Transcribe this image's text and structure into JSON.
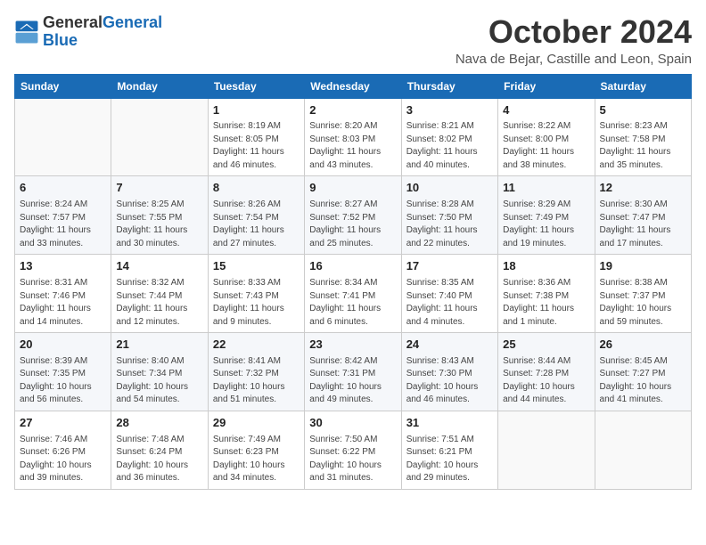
{
  "logo": {
    "line1": "General",
    "line2": "Blue"
  },
  "title": "October 2024",
  "location": "Nava de Bejar, Castille and Leon, Spain",
  "headers": [
    "Sunday",
    "Monday",
    "Tuesday",
    "Wednesday",
    "Thursday",
    "Friday",
    "Saturday"
  ],
  "weeks": [
    [
      {
        "day": "",
        "info": ""
      },
      {
        "day": "",
        "info": ""
      },
      {
        "day": "1",
        "info": "Sunrise: 8:19 AM\nSunset: 8:05 PM\nDaylight: 11 hours and 46 minutes."
      },
      {
        "day": "2",
        "info": "Sunrise: 8:20 AM\nSunset: 8:03 PM\nDaylight: 11 hours and 43 minutes."
      },
      {
        "day": "3",
        "info": "Sunrise: 8:21 AM\nSunset: 8:02 PM\nDaylight: 11 hours and 40 minutes."
      },
      {
        "day": "4",
        "info": "Sunrise: 8:22 AM\nSunset: 8:00 PM\nDaylight: 11 hours and 38 minutes."
      },
      {
        "day": "5",
        "info": "Sunrise: 8:23 AM\nSunset: 7:58 PM\nDaylight: 11 hours and 35 minutes."
      }
    ],
    [
      {
        "day": "6",
        "info": "Sunrise: 8:24 AM\nSunset: 7:57 PM\nDaylight: 11 hours and 33 minutes."
      },
      {
        "day": "7",
        "info": "Sunrise: 8:25 AM\nSunset: 7:55 PM\nDaylight: 11 hours and 30 minutes."
      },
      {
        "day": "8",
        "info": "Sunrise: 8:26 AM\nSunset: 7:54 PM\nDaylight: 11 hours and 27 minutes."
      },
      {
        "day": "9",
        "info": "Sunrise: 8:27 AM\nSunset: 7:52 PM\nDaylight: 11 hours and 25 minutes."
      },
      {
        "day": "10",
        "info": "Sunrise: 8:28 AM\nSunset: 7:50 PM\nDaylight: 11 hours and 22 minutes."
      },
      {
        "day": "11",
        "info": "Sunrise: 8:29 AM\nSunset: 7:49 PM\nDaylight: 11 hours and 19 minutes."
      },
      {
        "day": "12",
        "info": "Sunrise: 8:30 AM\nSunset: 7:47 PM\nDaylight: 11 hours and 17 minutes."
      }
    ],
    [
      {
        "day": "13",
        "info": "Sunrise: 8:31 AM\nSunset: 7:46 PM\nDaylight: 11 hours and 14 minutes."
      },
      {
        "day": "14",
        "info": "Sunrise: 8:32 AM\nSunset: 7:44 PM\nDaylight: 11 hours and 12 minutes."
      },
      {
        "day": "15",
        "info": "Sunrise: 8:33 AM\nSunset: 7:43 PM\nDaylight: 11 hours and 9 minutes."
      },
      {
        "day": "16",
        "info": "Sunrise: 8:34 AM\nSunset: 7:41 PM\nDaylight: 11 hours and 6 minutes."
      },
      {
        "day": "17",
        "info": "Sunrise: 8:35 AM\nSunset: 7:40 PM\nDaylight: 11 hours and 4 minutes."
      },
      {
        "day": "18",
        "info": "Sunrise: 8:36 AM\nSunset: 7:38 PM\nDaylight: 11 hours and 1 minute."
      },
      {
        "day": "19",
        "info": "Sunrise: 8:38 AM\nSunset: 7:37 PM\nDaylight: 10 hours and 59 minutes."
      }
    ],
    [
      {
        "day": "20",
        "info": "Sunrise: 8:39 AM\nSunset: 7:35 PM\nDaylight: 10 hours and 56 minutes."
      },
      {
        "day": "21",
        "info": "Sunrise: 8:40 AM\nSunset: 7:34 PM\nDaylight: 10 hours and 54 minutes."
      },
      {
        "day": "22",
        "info": "Sunrise: 8:41 AM\nSunset: 7:32 PM\nDaylight: 10 hours and 51 minutes."
      },
      {
        "day": "23",
        "info": "Sunrise: 8:42 AM\nSunset: 7:31 PM\nDaylight: 10 hours and 49 minutes."
      },
      {
        "day": "24",
        "info": "Sunrise: 8:43 AM\nSunset: 7:30 PM\nDaylight: 10 hours and 46 minutes."
      },
      {
        "day": "25",
        "info": "Sunrise: 8:44 AM\nSunset: 7:28 PM\nDaylight: 10 hours and 44 minutes."
      },
      {
        "day": "26",
        "info": "Sunrise: 8:45 AM\nSunset: 7:27 PM\nDaylight: 10 hours and 41 minutes."
      }
    ],
    [
      {
        "day": "27",
        "info": "Sunrise: 7:46 AM\nSunset: 6:26 PM\nDaylight: 10 hours and 39 minutes."
      },
      {
        "day": "28",
        "info": "Sunrise: 7:48 AM\nSunset: 6:24 PM\nDaylight: 10 hours and 36 minutes."
      },
      {
        "day": "29",
        "info": "Sunrise: 7:49 AM\nSunset: 6:23 PM\nDaylight: 10 hours and 34 minutes."
      },
      {
        "day": "30",
        "info": "Sunrise: 7:50 AM\nSunset: 6:22 PM\nDaylight: 10 hours and 31 minutes."
      },
      {
        "day": "31",
        "info": "Sunrise: 7:51 AM\nSunset: 6:21 PM\nDaylight: 10 hours and 29 minutes."
      },
      {
        "day": "",
        "info": ""
      },
      {
        "day": "",
        "info": ""
      }
    ]
  ]
}
